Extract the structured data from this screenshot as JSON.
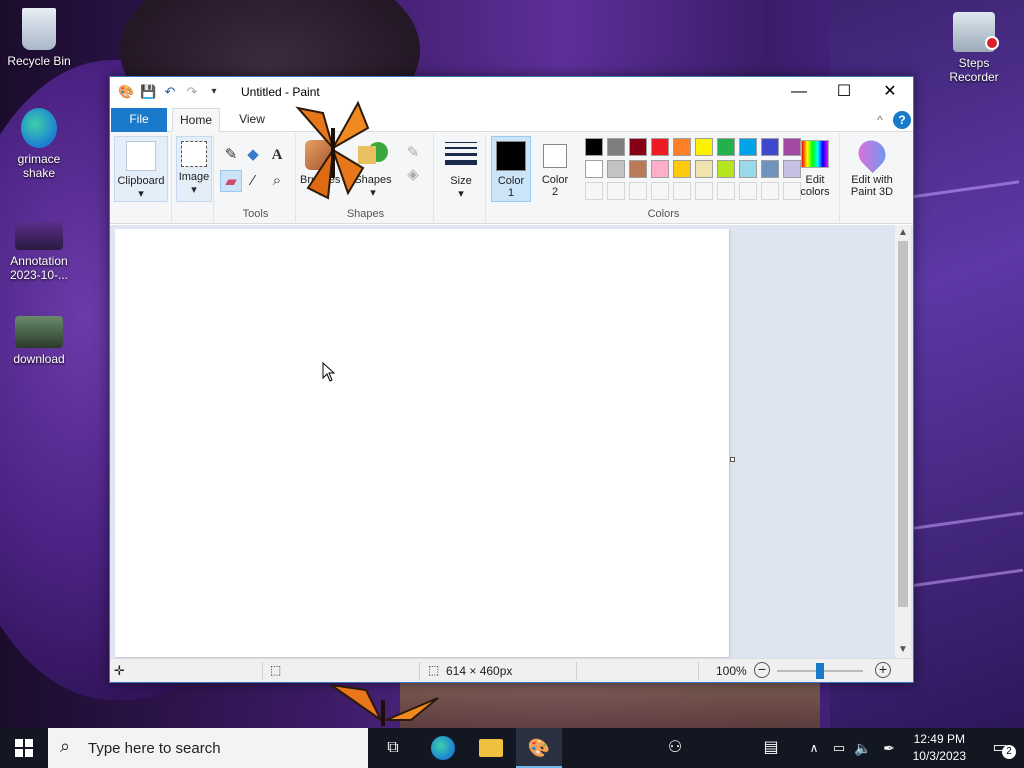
{
  "desktop": {
    "icons": [
      {
        "label": "Recycle Bin"
      },
      {
        "label": "grimace shake"
      },
      {
        "label": "Annotation 2023-10-..."
      },
      {
        "label": "download"
      },
      {
        "label": "Steps Recorder"
      }
    ]
  },
  "window": {
    "title": "Untitled - Paint",
    "controls": {
      "minimize": "—",
      "maximize": "☐",
      "close": "✕"
    }
  },
  "tabs": {
    "file": "File",
    "home": "Home",
    "view": "View",
    "collapse": "^",
    "help": "?"
  },
  "ribbon": {
    "clipboard": {
      "label": "Clipboard"
    },
    "image": {
      "label": "Image"
    },
    "tools": {
      "group_label": "Tools"
    },
    "brushes": {
      "label": "Brushes"
    },
    "shapes": {
      "label": "Shapes",
      "group_label": "Shapes"
    },
    "size": {
      "label": "Size"
    },
    "color1": {
      "label": "Color",
      "num": "1",
      "value": "#000000"
    },
    "color2": {
      "label": "Color",
      "num": "2",
      "value": "#ffffff"
    },
    "colors": {
      "group_label": "Colors"
    },
    "edit_colors": {
      "label": "Edit",
      "label2": "colors"
    },
    "paint3d": {
      "label": "Edit with",
      "label2": "Paint 3D"
    },
    "palette_row1": [
      "#000000",
      "#7f7f7f",
      "#880015",
      "#ed1c24",
      "#ff7f27",
      "#fff200",
      "#22b14c",
      "#00a2e8",
      "#3f48cc",
      "#a349a4"
    ],
    "palette_row2": [
      "#ffffff",
      "#c3c3c3",
      "#b97a57",
      "#ffaec9",
      "#ffc90e",
      "#efe4b0",
      "#b5e61d",
      "#99d9ea",
      "#7092be",
      "#c8bfe7"
    ]
  },
  "status": {
    "size": "614 × 460px",
    "zoom": "100%",
    "zoom_level": 0.5
  },
  "taskbar": {
    "search_placeholder": "Type here to search",
    "time": "12:49 PM",
    "date": "10/3/2023",
    "notifications": "2"
  }
}
